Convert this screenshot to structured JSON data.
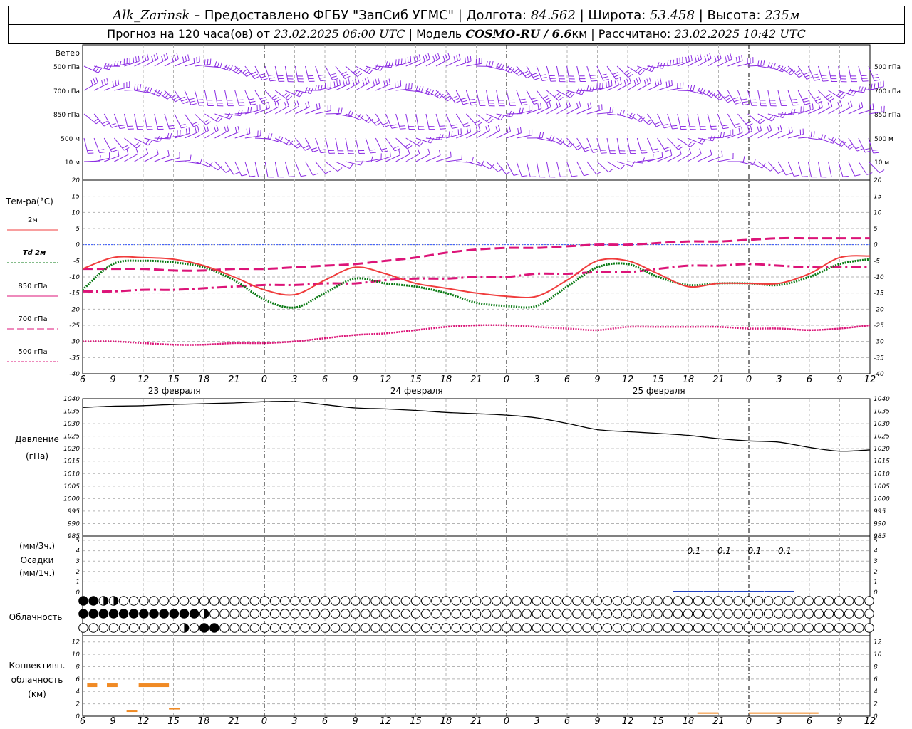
{
  "header": {
    "station": "Alk_Zarinsk",
    "provider": " – Предоставлено ФГБУ \"ЗапСиб УГМС\" | Долгота: ",
    "lon": "84.562",
    "lat_label": " | Широта: ",
    "lat": "53.458",
    "alt_label": " | Высота: ",
    "alt": "235м",
    "forecast_prefix": "Прогноз на 120 часа(ов) от ",
    "forecast_time": "23.02.2025 06:00 UTC",
    "model_label": "  | Модель ",
    "model": "COSMO-RU / 6.6",
    "model_unit": "км",
    "calc_label": " | Рассчитано: ",
    "calc_time": "23.02.2025 10:42 UTC"
  },
  "labels": {
    "wind_title": "Ветер",
    "wind_levels": [
      "500 гПа",
      "700 гПа",
      "850 гПа",
      "500 м",
      "10 м"
    ],
    "temp_title": "Тем-ра(°С)",
    "temp_legend": [
      "2м",
      "Td 2м",
      "850 гПа",
      "700 гПа",
      "500 гПа"
    ],
    "pressure_title": "Давление",
    "pressure_unit": "(гПа)",
    "precip_unit1": "(мм/3ч.)",
    "precip_title": "Осадки",
    "precip_unit2": "(мм/1ч.)",
    "cloud_title": "Облачность",
    "conv_title1": "Конвективн.",
    "conv_title2": "облачность",
    "conv_unit": "(км)",
    "dates": [
      "23 февраля",
      "24 февраля",
      "25 февраля"
    ]
  },
  "colors": {
    "t2m": "#f03c3c",
    "td2m": "#0a7a14",
    "t850": "#dc1478",
    "t700": "#dc1478",
    "t500": "#dc1478",
    "wind": "#8a2be2",
    "pressure": "#000000",
    "precip": "#1f3fbf",
    "convective": "#f08a24",
    "zero_line": "#3355ff",
    "grid": "#b4b4b4"
  },
  "chart_data": {
    "type": "line",
    "x_hours_utc": [
      6,
      9,
      12,
      15,
      18,
      21,
      0,
      3,
      6,
      9,
      12,
      15,
      18,
      21,
      0,
      3,
      6,
      9,
      12,
      15,
      18,
      21,
      0,
      3,
      6,
      9,
      12
    ],
    "temperature": {
      "ylim": [
        -40,
        20
      ],
      "yticks": [
        20,
        15,
        10,
        5,
        0,
        -5,
        -10,
        -15,
        -20,
        -25,
        -30,
        -35,
        -40
      ],
      "series": [
        {
          "name": "2м",
          "values": [
            -7.5,
            -4,
            -4,
            -4.5,
            -6.5,
            -10,
            -14,
            -15.5,
            -11,
            -7,
            -9,
            -12,
            -13.5,
            -15,
            -16,
            -16,
            -11,
            -5,
            -5,
            -9,
            -13,
            -12,
            -12,
            -12,
            -9,
            -4,
            -3.5
          ]
        },
        {
          "name": "Td 2м",
          "values": [
            -14,
            -6,
            -5,
            -5.5,
            -7,
            -11,
            -17,
            -19.5,
            -15,
            -10.5,
            -12,
            -13,
            -15,
            -18,
            -19,
            -19,
            -13,
            -7,
            -6,
            -10,
            -12.5,
            -12,
            -12,
            -12.5,
            -10,
            -6,
            -4.5
          ]
        },
        {
          "name": "850 гПа",
          "values": [
            -7.5,
            -7.5,
            -7.5,
            -8,
            -8,
            -7.5,
            -7.5,
            -7,
            -6.5,
            -6,
            -5,
            -4,
            -2.5,
            -1.5,
            -1,
            -1,
            -0.5,
            0,
            0,
            0.5,
            1,
            1,
            1.5,
            2,
            2,
            2,
            2
          ]
        },
        {
          "name": "700 гПа",
          "values": [
            -14.5,
            -14.5,
            -14,
            -14,
            -13.5,
            -13,
            -12.5,
            -12.5,
            -12,
            -12,
            -11,
            -10.5,
            -10.5,
            -10,
            -10,
            -9,
            -9,
            -8.5,
            -8.5,
            -7.5,
            -6.5,
            -6.5,
            -6,
            -6.5,
            -7,
            -7,
            -7
          ]
        },
        {
          "name": "500 гПа",
          "values": [
            -30,
            -30,
            -30.5,
            -31,
            -31,
            -30.5,
            -30.5,
            -30,
            -29,
            -28,
            -27.5,
            -26.5,
            -25.5,
            -25,
            -25,
            -25.5,
            -26,
            -26.5,
            -25.5,
            -25.5,
            -25.5,
            -25.5,
            -26,
            -26,
            -26.5,
            -26,
            -25
          ]
        }
      ]
    },
    "pressure": {
      "ylim": [
        985,
        1040
      ],
      "yticks": [
        1040,
        1035,
        1030,
        1025,
        1020,
        1015,
        1010,
        1005,
        1000,
        995,
        990,
        985
      ],
      "values": [
        1036.5,
        1037,
        1037.2,
        1037.7,
        1038,
        1038.3,
        1038.8,
        1038.9,
        1037.6,
        1036.3,
        1035.9,
        1035.3,
        1034.5,
        1034,
        1033.4,
        1032.3,
        1030.1,
        1027.6,
        1026.8,
        1026.1,
        1025.3,
        1024,
        1023.1,
        1022.6,
        1020.5,
        1019,
        1019.5
      ]
    },
    "precipitation": {
      "ylim": [
        0,
        5
      ],
      "yticks": [
        5,
        4,
        3,
        2,
        1,
        0
      ],
      "labels": [
        {
          "x_index": 20,
          "text": "0.1"
        },
        {
          "x_index": 21,
          "text": "0.1"
        },
        {
          "x_index": 22,
          "text": "0.1"
        },
        {
          "x_index": 23,
          "text": "0.1"
        }
      ],
      "values": [
        0,
        0,
        0,
        0,
        0,
        0,
        0,
        0,
        0,
        0,
        0,
        0,
        0,
        0,
        0,
        0,
        0,
        0,
        0,
        0,
        0.1,
        0.1,
        0.1,
        0.1,
        0,
        0,
        0
      ]
    },
    "cloudiness": {
      "columns": 79,
      "rows": [
        "FFHH1111111111111111111111111111111111111111111111111111111111111111111111111",
        "FFFFFFFFFFFFH11111111111111111111111111111111111111111111111111111111111111111",
        "1111111111H1FF1111111111111111111111111111111111111111111111111111111111111"
      ]
    },
    "convective": {
      "ylim": [
        0,
        13
      ],
      "yticks": [
        12,
        10,
        8,
        6,
        4,
        2,
        0
      ],
      "bars": [
        {
          "x_from": 0.15,
          "x_to": 0.48,
          "height": 5
        },
        {
          "x_from": 0.8,
          "x_to": 1.15,
          "height": 5
        },
        {
          "x_from": 1.85,
          "x_to": 2.85,
          "height": 5
        },
        {
          "x_from": 1.45,
          "x_to": 1.8,
          "height": 0.8
        },
        {
          "x_from": 2.85,
          "x_to": 3.2,
          "height": 1.2
        },
        {
          "x_from": 20.3,
          "x_to": 21.0,
          "height": 0.5
        },
        {
          "x_from": 22.0,
          "x_to": 24.3,
          "height": 0.5
        }
      ]
    }
  }
}
